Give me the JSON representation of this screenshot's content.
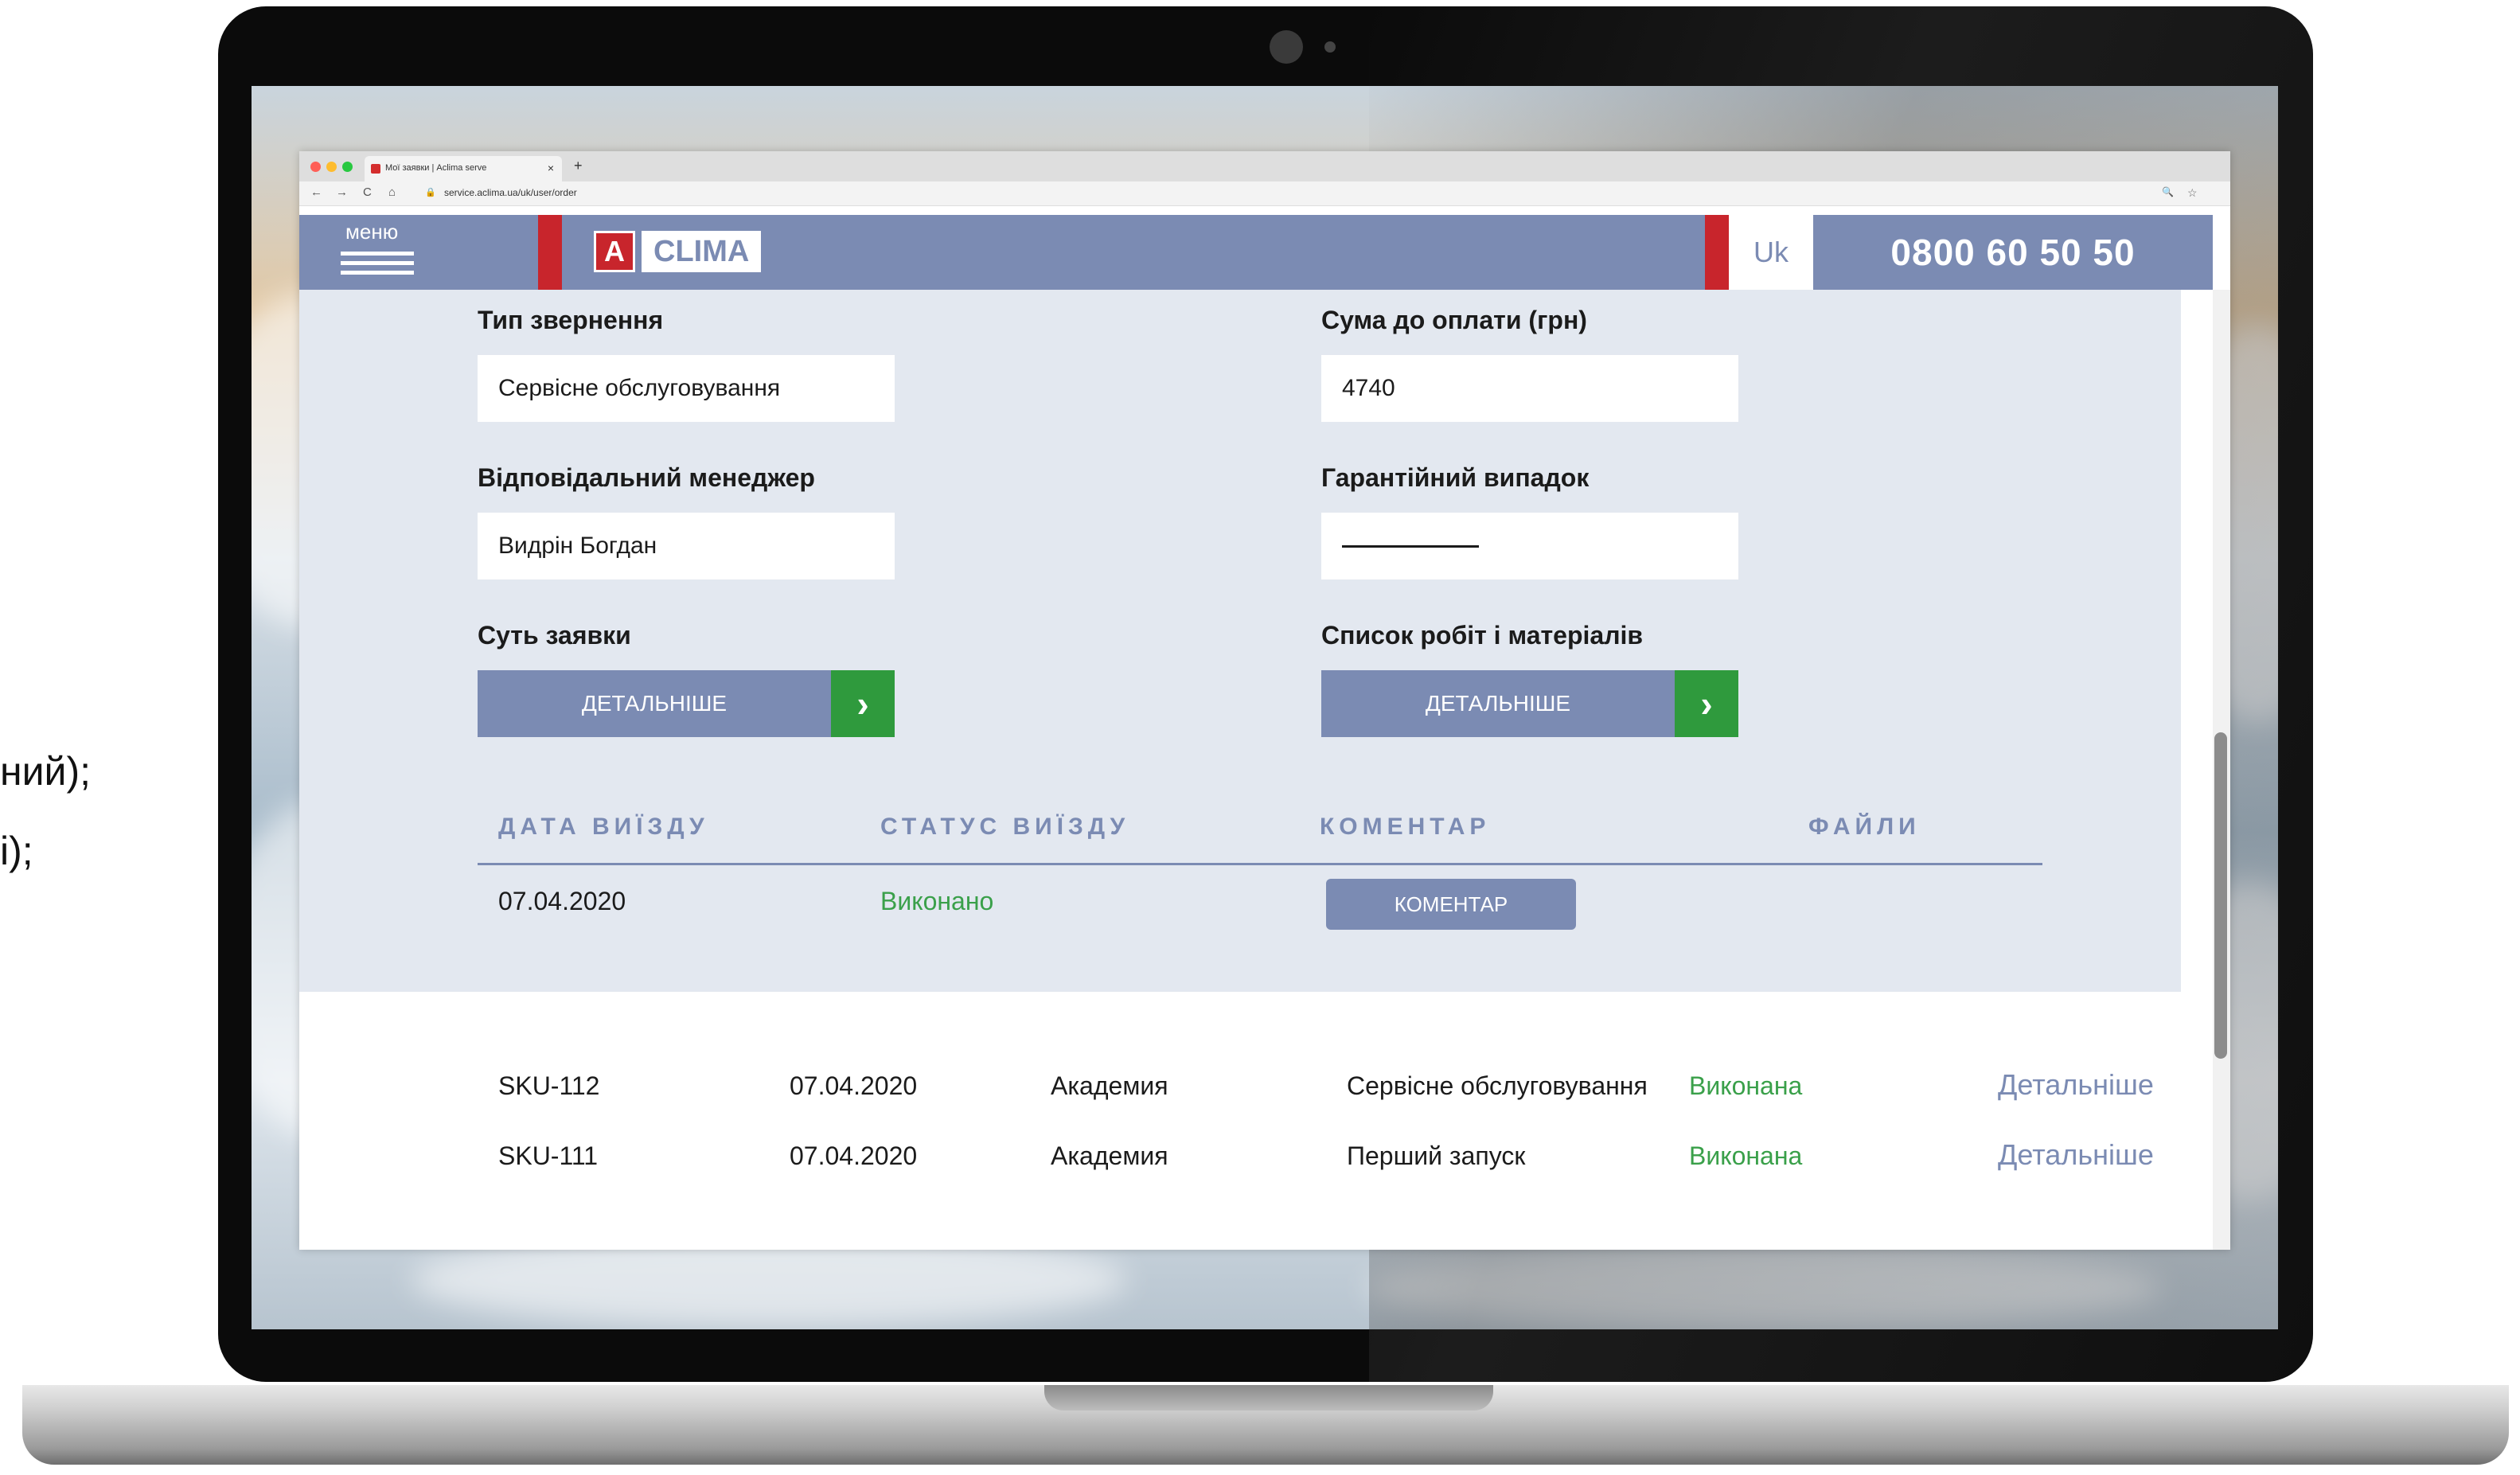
{
  "side_text": {
    "line1": "ний);",
    "line2": "і);"
  },
  "browser": {
    "tab_title": "Мої заявки | Aclima serve",
    "tab_close": "×",
    "new_tab": "+",
    "url": "service.aclima.ua/uk/user/order",
    "nav_back": "←",
    "nav_forward": "→",
    "nav_reload": "C",
    "nav_home": "⌂",
    "zoom_icon": "🔍",
    "star_icon": "☆"
  },
  "header": {
    "menu_label": "меню",
    "logo_a": "A",
    "logo_text": "CLIMA",
    "language": "Uk",
    "phone": "0800 60 50 50"
  },
  "order": {
    "appeal_type_label": "Тип звернення",
    "appeal_type_value": "Сервісне обслуговування",
    "amount_label": "Сума до оплати (грн)",
    "amount_value": "4740",
    "manager_label": "Відповідальний менеджер",
    "manager_value": "Видрін Богдан",
    "warranty_label": "Гарантійний випадок",
    "essence_label": "Суть заявки",
    "essence_button": "ДЕТАЛЬНІШЕ",
    "works_label": "Список робіт і матеріалів",
    "works_button": "ДЕТАЛЬНІШЕ",
    "arrow": "›"
  },
  "visits": {
    "headers": {
      "date": "ДАТА ВИЇЗДУ",
      "status": "СТАТУС ВИЇЗДУ",
      "comment": "КОМЕНТАР",
      "files": "ФАЙЛИ"
    },
    "rows": [
      {
        "date": "07.04.2020",
        "status": "Виконано",
        "comment_button": "КОМЕНТАР"
      }
    ]
  },
  "orders_list": [
    {
      "sku": "SKU-112",
      "date": "07.04.2020",
      "location": "Академия",
      "type": "Сервісне обслуговування",
      "status": "Виконана",
      "link": "Детальніше"
    },
    {
      "sku": "SKU-111",
      "date": "07.04.2020",
      "location": "Академия",
      "type": "Перший запуск",
      "status": "Виконана",
      "link": "Детальніше"
    }
  ],
  "colors": {
    "brand_blue": "#7b8bb3",
    "brand_red": "#c8252c",
    "status_green": "#3aa04a",
    "button_green": "#2f9a3d"
  }
}
